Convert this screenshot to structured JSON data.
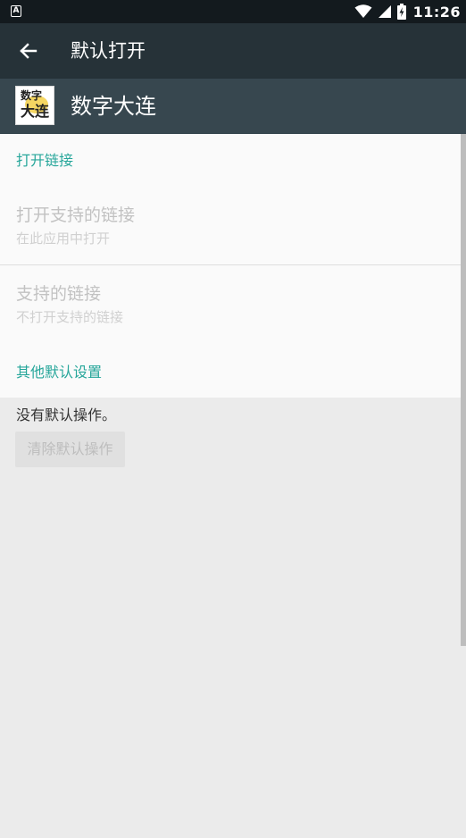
{
  "status_bar": {
    "time": "11:26",
    "notification_icon": "A",
    "icons": [
      "wifi-icon",
      "cell-signal-icon",
      "battery-charging-icon"
    ]
  },
  "toolbar": {
    "title": "默认打开",
    "back_icon": "arrow-left-icon"
  },
  "app": {
    "name": "数字大连",
    "icon_text_top": "数字",
    "icon_text_bottom": "大连"
  },
  "open_links": {
    "header": "打开链接",
    "open_supported": {
      "title": "打开支持的链接",
      "summary": "在此应用中打开"
    },
    "supported_links": {
      "title": "支持的链接",
      "summary": "不打开支持的链接"
    }
  },
  "other_defaults": {
    "header": "其他默认设置",
    "no_defaults": "没有默认操作。",
    "clear_button": "清除默认操作"
  },
  "colors": {
    "accent": "#26a69a",
    "toolbar": "#263238",
    "app_header": "#37474f",
    "status_bar": "#131a1e"
  }
}
